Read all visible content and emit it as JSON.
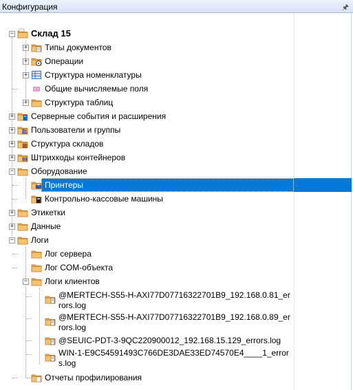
{
  "window": {
    "title": "Конфигурация",
    "pin_glyph": "ᵖ"
  },
  "tree": {
    "root": {
      "label": "Склад 15",
      "icon": "folder-open-icon"
    },
    "doc_types": {
      "label": "Типы документов"
    },
    "operations": {
      "label": "Операции"
    },
    "nomenclature": {
      "label": "Структура номенклатуры"
    },
    "calc_fields": {
      "label": "Общие вычисляемые поля"
    },
    "tables": {
      "label": "Структура таблиц"
    },
    "server_events": {
      "label": "Серверные события и расширения"
    },
    "users": {
      "label": "Пользователи и группы"
    },
    "warehouse": {
      "label": "Структура складов"
    },
    "barcodes": {
      "label": "Штрихкоды контейнеров"
    },
    "equipment": {
      "label": "Оборудование"
    },
    "printers": {
      "label": "Принтеры"
    },
    "cash": {
      "label": "Контрольно-кассовые машины"
    },
    "labels": {
      "label": "Этикетки"
    },
    "data": {
      "label": "Данные"
    },
    "logs": {
      "label": "Логи"
    },
    "server_log": {
      "label": "Лог сервера"
    },
    "com_log": {
      "label": "Лог COM-объекта"
    },
    "client_logs": {
      "label": "Логи клиентов"
    },
    "log_files": [
      "@MERTECH-S55-H-AXI77D07716322701B9_192.168.0.81_errors.log",
      "@MERTECH-S55-H-AXI77D07716322701B9_192.168.0.89_errors.log",
      "@SEUIC-PDT-3-9QC220900012_192.168.15.129_errors.log",
      "WIN-1-E9C54591493C766DE3DAE33ED74570E4____1_errors.log"
    ],
    "profiling": {
      "label": "Отчеты профилирования"
    }
  },
  "colors": {
    "selection": "#0078d7",
    "folder": "#e8a44a",
    "title_bg": "#d6e2f4"
  }
}
